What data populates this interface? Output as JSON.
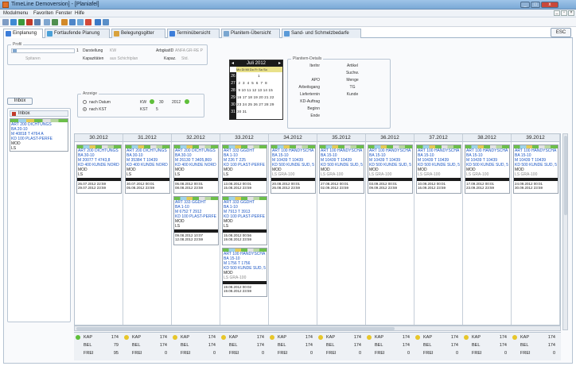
{
  "window": {
    "title": "TimeLine Demoversion] - [Planiafel]",
    "min_label": "_",
    "max_label": "□",
    "close_label": "x"
  },
  "menu": {
    "items": [
      "Modulmenu",
      "Favoriten",
      "Fenster",
      "Hilfe"
    ]
  },
  "tabs": [
    {
      "label": "Einplanung",
      "color": "#3c7dd9"
    },
    {
      "label": "Fortlaufende Planung",
      "color": "#4aa0d8"
    },
    {
      "label": "Belegungsgitter",
      "color": "#d9a23c"
    },
    {
      "label": "Terminübersicht",
      "color": "#3c7dd9"
    },
    {
      "label": "Planitem-Übersicht",
      "color": "#7aa6d0"
    },
    {
      "label": "Sand- und Schmelzbedarfe",
      "color": "#5a9ad8"
    }
  ],
  "esc_label": "ESC",
  "profil": {
    "legend": "Profil",
    "value": "1",
    "darstellung_label": "Darstellung",
    "darstellung_value": "KW",
    "spitaren_label": "Spitaren",
    "kapazitaeten_label": "Kapazitäten",
    "kapazitaeten_value": "aus Schichtplan",
    "arbgkatid_label": "ArbgkatID",
    "arbgkatid_value": "ANFA GR-RE P",
    "kapaz_label": "Kapaz.",
    "kapaz_value": "Std."
  },
  "anzeige": {
    "legend": "Anzeige",
    "opt1": "nach Datum",
    "opt2": "nach KST",
    "kw_label": "KW",
    "kw_value": "30",
    "year_value": "2012",
    "kst_label": "KST",
    "kst_value": "5"
  },
  "calendar": {
    "month": "Juli 2012",
    "dow": "Mo Di Mi Do Fr Sa So",
    "weeks": [
      "26",
      "27",
      "28",
      "29",
      "30",
      "31"
    ],
    "rows": [
      "                  1",
      " 2  3  4  5  6  7  8",
      " 9 10 11 12 13 14 15",
      "16 17 18 19 20 21 22",
      "23 24 25 26 27 28 29",
      "30 31"
    ]
  },
  "planitem": {
    "legend": "Planitem-Details",
    "left_labels": [
      "Iterlnr",
      "",
      "APO",
      "Arbeitsgang",
      "Lieferternin",
      "KD-Auftrag",
      "Beginn",
      "Ende"
    ],
    "right_labels": [
      "Artikel",
      "Suchw.",
      "Menge",
      "TG",
      "Kunde"
    ]
  },
  "inbox": {
    "button": "Inbox",
    "tab": "Inbox",
    "card_lines": [
      "ART 200 DICHTUNGS",
      "BA 20-10",
      "M 40818 T 4764 A",
      "KD 100 PLAST-PERFE",
      "MOD",
      "LS"
    ]
  },
  "weeks": [
    "30.2012",
    "31.2012",
    "32.2012",
    "33.2012",
    "34.2012",
    "35.2012",
    "36.2012",
    "37.2012",
    "38.2012",
    "39.2012"
  ],
  "row1": [
    {
      "lines": [
        "ART 200 DICHTUNGS",
        "BA 30-10",
        "M 20077 T 4743,8",
        "KD 400 KUNDE NORD",
        "MOD",
        "LS"
      ],
      "d1": "26.07.2012 22:59",
      "d2": "29.07.2012 23:59"
    },
    {
      "lines": [
        "ART 200 DICHTUNGS",
        "BA 30-10",
        "M 35384 T 10439",
        "KD 400 KUNDE NORD",
        "MOD",
        "LS"
      ],
      "d1": "30.07.2012 00:01",
      "d2": "05.08.2012 23:59"
    },
    {
      "lines": [
        "ART 200 DICHTUNGS",
        "BA 30-10",
        "M 26130 T 3405,869",
        "KD 400 KUNDE NORD",
        "MOD",
        "LS"
      ],
      "d1": "06.08.2012 00:01",
      "d2": "08.08.2012 23:59"
    },
    {
      "lines": [
        "ART 333 GGDHT",
        "BA 1-10",
        "M 226 T 225",
        "KD 100 PLAST-PERFE",
        "MOD",
        "LS"
      ],
      "d1": "13.08.2012 00:01",
      "d2": "15.08.2012 23:59"
    },
    {
      "lines": [
        "ART 100 HANDYSCHA",
        "BA 15-10",
        "M 10439 T 10439",
        "KD 500 KUNDE SÜD, 5",
        "MOD",
        "LS   GRA-100"
      ],
      "d1": "20.08.2012 00:01",
      "d2": "26.08.2012 23:59"
    },
    {
      "lines": [
        "ART 100 HANDYSCHA",
        "BA 15-10",
        "M 10439 T 10439",
        "KD 500 KUNDE SÜD, 5",
        "MOD",
        "LS   GRA-100"
      ],
      "d1": "27.08.2012 00:01",
      "d2": "02.09.2012 23:59"
    },
    {
      "lines": [
        "ART 100 HANDYSCHA",
        "BA 15-10",
        "M 10439 T 10439",
        "KD 500 KUNDE SÜD, 5",
        "MOD",
        "LS   GRA-100"
      ],
      "d1": "03.09.2012 00:01",
      "d2": "09.09.2012 23:59"
    },
    {
      "lines": [
        "ART 100 HANDYSCHA",
        "BA 15-10",
        "M 10439 T 10439",
        "KD 500 KUNDE SÜD, 5",
        "MOD",
        "LS   GRA-100"
      ],
      "d1": "10.09.2012 00:01",
      "d2": "16.09.2012 23:59"
    },
    {
      "lines": [
        "ART 100 HANDYSCHA",
        "BA 15-10",
        "M 10439 T 10439",
        "KD 500 KUNDE SÜD, 5",
        "MOD",
        "LS   GRA-100"
      ],
      "d1": "17.09.2012 00:01",
      "d2": "23.09.2012 23:59"
    },
    {
      "lines": [
        "ART 100 HANDYSCHA",
        "BA 15-10",
        "M 10439 T 10439",
        "KD 500 KUNDE SÜD, 5",
        "MOD",
        "LS   GRA-100"
      ],
      "d1": "24.09.2012 00:01",
      "d2": "30.09.2012 23:59"
    }
  ],
  "extra_cards": [
    {
      "col": 2,
      "row": 2,
      "lines": [
        "ART 333 GGDHT",
        "BA 1-10",
        "M 6752 T 2912",
        "KD 100 PLAST-PERFE",
        "MOD",
        "LS"
      ],
      "d1": "09.08.2012 10:07",
      "d2": "12.08.2012 23:59"
    },
    {
      "col": 3,
      "row": 2,
      "lines": [
        "ART 333 GGDHT",
        "BA 1-10",
        "M 7913 T 3913",
        "KD 100 PLAST-PERFE",
        "MOD",
        "LS"
      ],
      "d1": "15.08.2012 00:56",
      "d2": "19.08.2012 23:59"
    },
    {
      "col": 3,
      "row": 3,
      "lines": [
        "ART 100 HANDYSCHA",
        "BA 15-10",
        "M 1756 T 1756",
        "KD 500 KUNDE SÜD, 5",
        "MOD",
        "LS   GRA-100"
      ],
      "d1": "19.08.2012 00:02",
      "d2": "19.08.2012 23:59"
    }
  ],
  "stats": [
    {
      "kap": "174",
      "bel": "79",
      "frei": "95"
    },
    {
      "kap": "174",
      "bel": "174",
      "frei": "0"
    },
    {
      "kap": "174",
      "bel": "174",
      "frei": "0"
    },
    {
      "kap": "174",
      "bel": "174",
      "frei": "0"
    },
    {
      "kap": "174",
      "bel": "174",
      "frei": "0"
    },
    {
      "kap": "174",
      "bel": "174",
      "frei": "0"
    },
    {
      "kap": "174",
      "bel": "174",
      "frei": "0"
    },
    {
      "kap": "174",
      "bel": "174",
      "frei": "0"
    },
    {
      "kap": "174",
      "bel": "174",
      "frei": "0"
    },
    {
      "kap": "174",
      "bel": "174",
      "frei": "0"
    }
  ],
  "stat_labels": {
    "kap": "KAP",
    "bel": "BEL",
    "frei": "FREI"
  },
  "colors": {
    "green_dot": "#5fbf3a",
    "yellow_dot": "#e7c62a",
    "title_blue": "#1a55c4"
  }
}
